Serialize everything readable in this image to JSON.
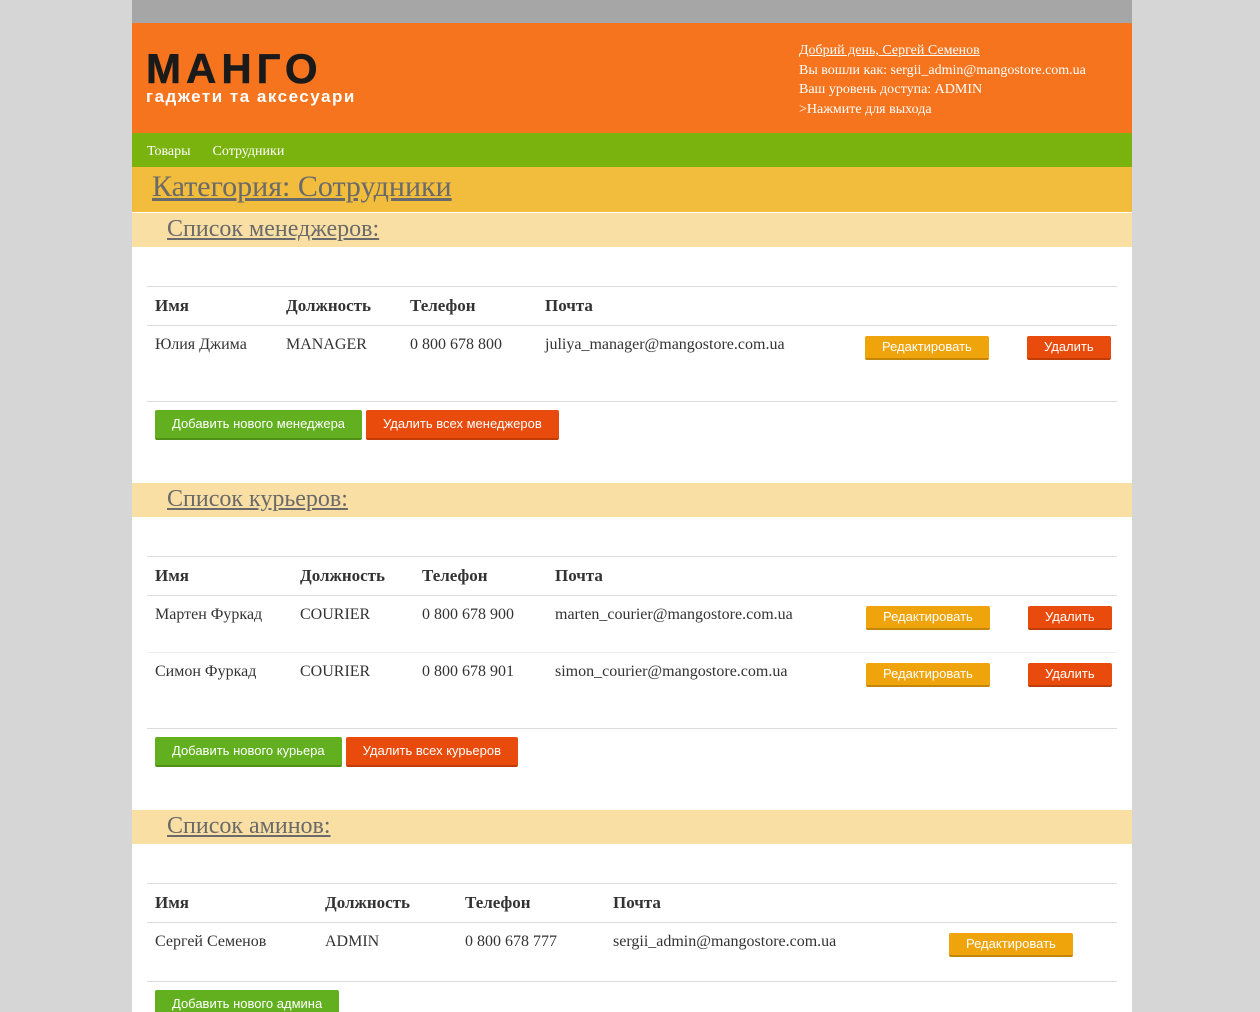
{
  "header": {
    "logo_main": "МАНГО",
    "logo_sub": "гаджети та аксесуари",
    "greeting": "Добрий день, Сергей Семенов",
    "logged_as": "Вы вошли как: sergii_admin@mangostore.com.ua",
    "access_level": "Ваш уровень доступа: ADMIN",
    "logout": ">Нажмите для выхода"
  },
  "nav": {
    "items": [
      "Товары",
      "Сотрудники"
    ]
  },
  "category_title": "Категория: Сотрудники",
  "columns": [
    "Имя",
    "Должность",
    "Телефон",
    "Почта"
  ],
  "buttons": {
    "edit": "Редактировать",
    "delete": "Удалить"
  },
  "sections": {
    "managers": {
      "title": "Список менеджеров:",
      "rows": [
        {
          "name": "Юлия Джима",
          "role": "MANAGER",
          "phone": "0 800 678 800",
          "email": "juliya_manager@mangostore.com.ua"
        }
      ],
      "add_label": "Добавить нового менеджера",
      "delete_all_label": "Удалить всех менеджеров"
    },
    "couriers": {
      "title": "Список курьеров:",
      "rows": [
        {
          "name": "Мартен Фуркад",
          "role": "COURIER",
          "phone": "0 800 678 900",
          "email": "marten_courier@mangostore.com.ua"
        },
        {
          "name": "Симон Фуркад",
          "role": "COURIER",
          "phone": "0 800 678 901",
          "email": "simon_courier@mangostore.com.ua"
        }
      ],
      "add_label": "Добавить нового курьера",
      "delete_all_label": "Удалить всех курьеров"
    },
    "admins": {
      "title": "Список аминов:",
      "rows": [
        {
          "name": "Сергей Семенов",
          "role": "ADMIN",
          "phone": "0 800 678 777",
          "email": "sergii_admin@mangostore.com.ua"
        }
      ],
      "add_label": "Добавить нового админа"
    }
  },
  "colors": {
    "header_bg": "#f5741d",
    "nav_bg": "#7ab30e",
    "category_bg": "#f2bc3c",
    "section_bg": "#f9dfa3",
    "edit_btn": "#f0a40c",
    "delete_btn": "#e84b0b",
    "add_btn": "#62b01f"
  }
}
